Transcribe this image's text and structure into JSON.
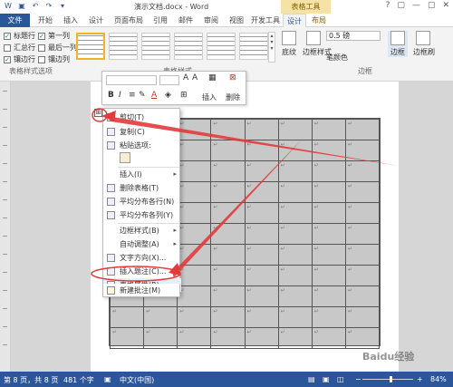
{
  "titlebar": {
    "title": "演示文档.docx - Word",
    "contextual_group": "表格工具",
    "controls": [
      "?",
      "▢",
      "—",
      "▢",
      "✕"
    ]
  },
  "tabs": [
    "文件",
    "开始",
    "插入",
    "设计",
    "页面布局",
    "引用",
    "邮件",
    "审阅",
    "视图",
    "开发工具",
    "设计",
    "布局"
  ],
  "ribbon": {
    "options": {
      "header_row": "标题行",
      "first_column": "第一列",
      "total_row": "汇总行",
      "last_column": "最后一列",
      "banded_rows": "镶边行",
      "banded_columns": "镶边列",
      "group_label": "表格样式选项"
    },
    "styles_group_label": "表格样式",
    "shading_label": "底纹",
    "border_styles_label": "边框样式",
    "line_weight": "0.5 磅",
    "pen_color_label": "笔颜色",
    "borders_label": "边框",
    "border_painter_label": "边框刷",
    "borders_group_label": "边框"
  },
  "minitoolbar": {
    "insert_label": "插入",
    "delete_label": "删除",
    "bold": "B",
    "italic": "I",
    "font_color_letter": "A"
  },
  "context_menu": {
    "items": [
      {
        "label": "剪切(T)"
      },
      {
        "label": "复制(C)"
      },
      {
        "label": "粘贴选项:"
      },
      {
        "label": "插入(I)",
        "arrow": "▸"
      },
      {
        "label": "删除表格(T)"
      },
      {
        "label": "平均分布各行(N)"
      },
      {
        "label": "平均分布各列(Y)"
      },
      {
        "label": "边框样式(B)",
        "arrow": "▸"
      },
      {
        "label": "自动调整(A)",
        "arrow": "▸"
      },
      {
        "label": "文字方向(X)..."
      },
      {
        "label": "插入题注(C)..."
      },
      {
        "label": "表格属性(R)..."
      },
      {
        "label": "新建批注(M)"
      }
    ],
    "highlighted_index": 11
  },
  "table": {
    "rows": 11,
    "cols": 8,
    "cell_mark": "↵",
    "handle_glyph": "⊞"
  },
  "statusbar": {
    "page": "第 8 页，共 8 页",
    "words": "481 个字",
    "language": "中文(中国)",
    "zoom": "84%",
    "zoom_minus": "−",
    "zoom_plus": "+"
  },
  "colors": {
    "accent": "#2b579a",
    "annotation_red": "#e23b3b",
    "table_fill": "#c8c8c8",
    "contextual_tab": "#f4e2a6"
  },
  "watermark_text": "Baidu经验"
}
